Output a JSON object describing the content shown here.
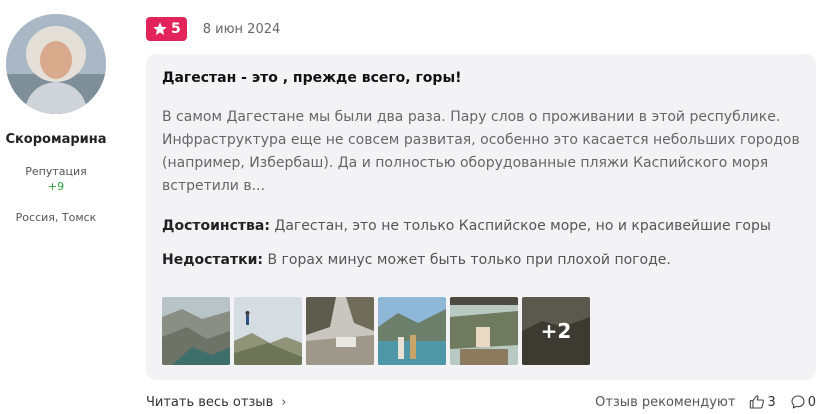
{
  "author": {
    "name": "Скоромарина",
    "reputation_label": "Репутация",
    "reputation_value": "+9",
    "location": "Россия, Томск"
  },
  "review": {
    "rating": "5",
    "date": "8 июн 2024",
    "title": "Дагестан - это , прежде всего, горы!",
    "body": "В самом Дагестане мы были два раза. Пару слов о проживании в этой республике. Инфраструктура еще не совсем развитая, особенно это касается небольших городов (например, Избербаш). Да и полностью оборудованные пляжи Каспийского моря встретили в...",
    "pros_label": "Достоинства:",
    "pros_text": "Дагестан, это не только Каспийское море, но и красивейшие горы",
    "cons_label": "Недостатки:",
    "cons_text": "В горах минус может быть только при плохой погоде.",
    "more_photos": "+2"
  },
  "footer": {
    "read_full": "Читать весь отзыв",
    "recommend_label": "Отзыв рекомендуют",
    "likes": "3",
    "comments": "0"
  },
  "colors": {
    "accent": "#e3245a",
    "reputation": "#2ea043",
    "card_bg": "#f3f3f5"
  },
  "icons": {
    "rating": "star-icon",
    "read_more": "chevron-right-icon",
    "like": "thumbs-up-icon",
    "comment": "comment-icon"
  }
}
